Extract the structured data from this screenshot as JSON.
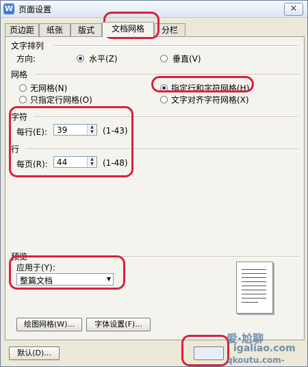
{
  "window": {
    "title": "页面设置",
    "app_icon": "W",
    "close": "×"
  },
  "tabs": [
    {
      "label": "页边距",
      "active": false
    },
    {
      "label": "纸张",
      "active": false
    },
    {
      "label": "版式",
      "active": false
    },
    {
      "label": "文档网格",
      "active": true
    },
    {
      "label": "分栏",
      "active": false
    }
  ],
  "text_direction": {
    "heading": "文字排列",
    "label": "方向:",
    "options": [
      {
        "label": "水平(Z)",
        "selected": true
      },
      {
        "label": "垂直(V)",
        "selected": false
      }
    ]
  },
  "grid": {
    "heading": "网格",
    "options": [
      {
        "label": "无网格(N)",
        "selected": false
      },
      {
        "label": "只指定行网格(O)",
        "selected": false
      },
      {
        "label": "指定行和字符网格(H)",
        "selected": true
      },
      {
        "label": "文字对齐字符网格(X)",
        "selected": false
      }
    ]
  },
  "chars": {
    "heading": "字符",
    "label": "每行(E):",
    "value": "39",
    "range": "(1-43)"
  },
  "lines": {
    "heading": "行",
    "label": "每页(R):",
    "value": "44",
    "range": "(1-48)"
  },
  "preview": {
    "heading": "预览",
    "apply_label": "应用于(Y):",
    "apply_value": "整篇文档"
  },
  "buttons": {
    "draw_grid": "绘图网格(W)...",
    "font_settings": "字体设置(F)...",
    "default": "默认(D)..."
  },
  "watermark": {
    "brand": "爱·尬聊",
    "url": "igaliao.com",
    "url2": "qkoutu.com-"
  },
  "colors": {
    "highlight": "#d8213a",
    "accent": "#3f7fd6"
  }
}
